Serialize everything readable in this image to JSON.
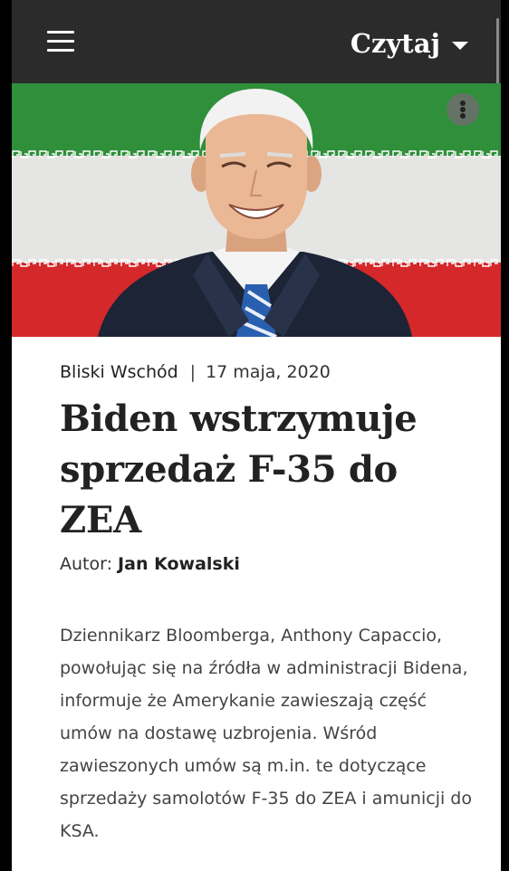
{
  "header": {
    "menu_icon": "hamburger-menu-icon",
    "read_label": "Czytaj",
    "read_dropdown_icon": "caret-down-icon"
  },
  "hero": {
    "options_icon": "more-vertical-icon",
    "colors": {
      "green": "#2f8f3a",
      "white": "#e8e8e8",
      "red": "#d4282b",
      "suit": "#1c2436"
    }
  },
  "article": {
    "category": "Bliski Wschód",
    "separator": "|",
    "date": "17 maja, 2020",
    "title": "Biden wstrzymuje sprzedaż F-35 do ZEA",
    "author_label": "Autor:",
    "author_name": "Jan Kowalski",
    "body": "Dziennikarz Bloomberga, Anthony Capaccio, powołując się na źródła w administracji Bidena, informuje że Amerykanie zawieszają część umów na dostawę uzbrojenia. Wśród zawieszonych umów są m.in. te dotyczące sprzedaży samolotów F-35 do ZEA i amunicji do KSA."
  }
}
